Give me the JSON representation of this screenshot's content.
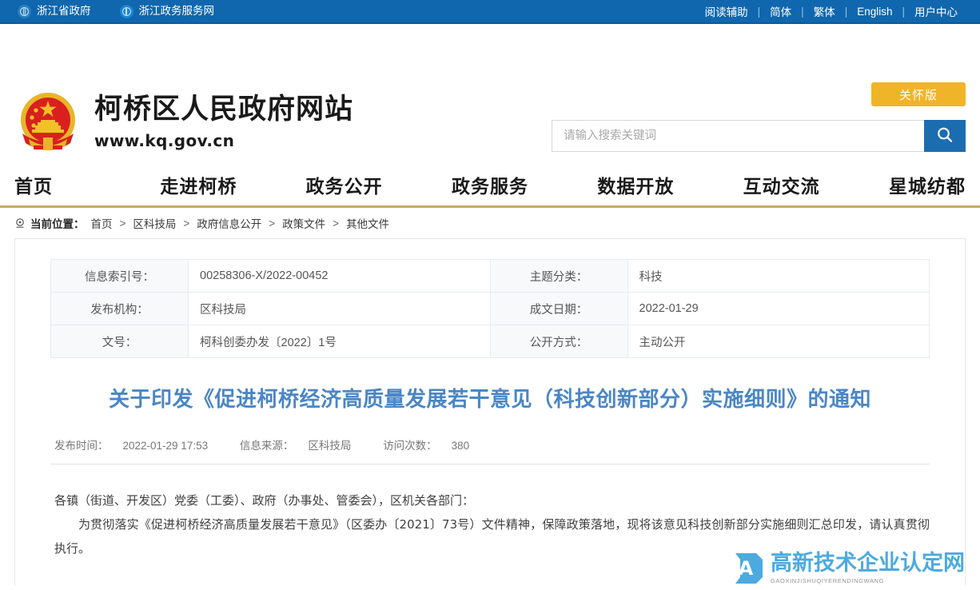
{
  "topbar": {
    "left_links": [
      {
        "label": "浙江省政府",
        "icon": "globe-icon"
      },
      {
        "label": "浙江政务服务网",
        "icon": "globe-icon"
      }
    ],
    "right_links": [
      "阅读辅助",
      "简体",
      "繁体",
      "English",
      "用户中心"
    ],
    "separator": "|",
    "background": "#1067ad"
  },
  "header": {
    "emblem_icon": "national-emblem-icon",
    "site_title": "柯桥区人民政府网站",
    "site_url": "www.kq.gov.cn",
    "care_button": "关怀版",
    "care_button_color": "#f0b429",
    "search": {
      "placeholder": "请输入搜索关键词",
      "value": "",
      "button_icon": "search-icon",
      "button_color": "#1c6cb0"
    }
  },
  "nav": {
    "items": [
      "首页",
      "走进柯桥",
      "政务公开",
      "政务服务",
      "数据开放",
      "互动交流",
      "星城纺都"
    ],
    "underline_color": "#c8a96a"
  },
  "breadcrumb": {
    "pin_icon": "location-pin-icon",
    "label": "当前位置：",
    "items": [
      "首页",
      "区科技局",
      "政府信息公开",
      "政策文件",
      "其他文件"
    ],
    "arrow": ">"
  },
  "info_table": {
    "rows": [
      {
        "left_label": "信息索引号：",
        "left_value": "00258306-X/2022-00452",
        "right_label": "主题分类：",
        "right_value": "科技"
      },
      {
        "left_label": "发布机构：",
        "left_value": "区科技局",
        "right_label": "成文日期：",
        "right_value": "2022-01-29"
      },
      {
        "left_label": "文号：",
        "left_value": "柯科创委办发〔2022〕1号",
        "right_label": "公开方式：",
        "right_value": "主动公开"
      }
    ]
  },
  "document": {
    "title": "关于印发《促进柯桥经济高质量发展若干意见（科技创新部分）实施细则》的通知",
    "title_color": "#4a86c5",
    "meta": {
      "publish_time_label": "发布时间：",
      "publish_time": "2022-01-29 17:53",
      "source_label": "信息来源：",
      "source": "区科技局",
      "views_label": "访问次数：",
      "views": "380"
    },
    "paragraphs": [
      "各镇（街道、开发区）党委（工委）、政府（办事处、管委会），区机关各部门：",
      "为贯彻落实《促进柯桥经济高质量发展若干意见》（区委办〔2021〕73号）文件精神，保障政策落地，现将该意见科技创新部分实施细则汇总印发，请认真贯彻执行。"
    ]
  },
  "watermark": {
    "badge_letter": "A",
    "main_text": "高新技术企业认定网",
    "sub_text": "GAOXINJISHUQIYERENDINGWANG",
    "color": "#3da3dd"
  }
}
